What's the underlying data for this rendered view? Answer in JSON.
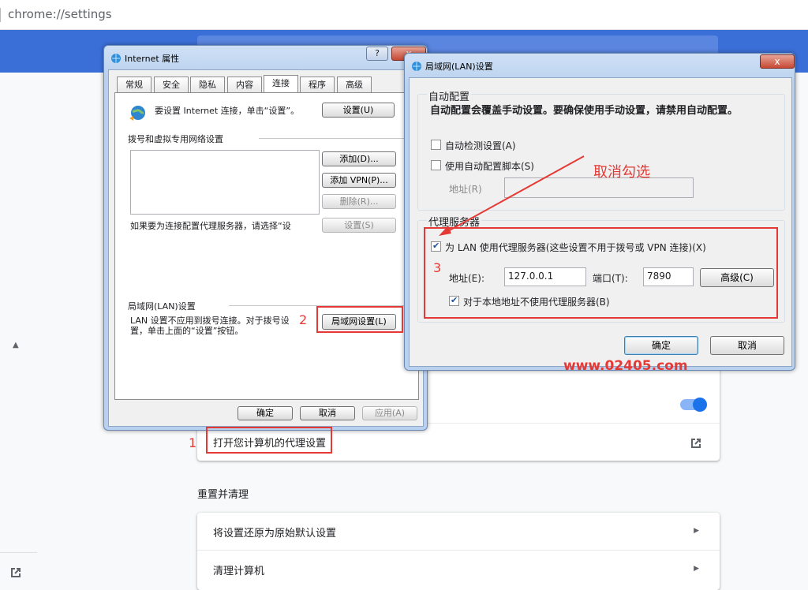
{
  "browser": {
    "url": "chrome://settings"
  },
  "settings": {
    "proxy_row_label": "打开您计算机的代理设置",
    "reset_section_title": "重置并清理",
    "reset_items": [
      "将设置还原为原始默认设置",
      "清理计算机"
    ]
  },
  "ie_dialog": {
    "title": "Internet 属性",
    "help_btn": "?",
    "close_btn": "x",
    "tabs": [
      "常规",
      "安全",
      "隐私",
      "内容",
      "连接",
      "程序",
      "高级"
    ],
    "active_tab": "连接",
    "setup_text": "要设置 Internet 连接，单击“设置”。",
    "setup_btn": "设置(U)",
    "dialup_group": "拨号和虚拟专用网络设置",
    "add_btn": "添加(D)...",
    "add_vpn_btn": "添加 VPN(P)...",
    "delete_btn": "删除(R)...",
    "proxy_hint": "如果要为连接配置代理服务器，请选择“设",
    "settings_btn": "设置(S)",
    "lan_group": "局域网(LAN)设置",
    "lan_text_1": "LAN 设置不应用到拨号连接。对于拨号设",
    "lan_text_2": "置，单击上面的“设置”按钮。",
    "lan_btn": "局域网设置(L)",
    "ok_btn": "确定",
    "cancel_btn": "取消",
    "apply_btn": "应用(A)"
  },
  "lan_dialog": {
    "title": "局域网(LAN)设置",
    "close_btn": "x",
    "auto_group": "自动配置",
    "auto_desc": "自动配置会覆盖手动设置。要确保使用手动设置，请禁用自动配置。",
    "auto_detect": {
      "label": "自动检测设置(A)",
      "checked": false
    },
    "auto_script": {
      "label": "使用自动配置脚本(S)",
      "checked": false
    },
    "address_label": "地址(R)",
    "proxy_group": "代理服务器",
    "use_proxy": {
      "label": "为 LAN 使用代理服务器(这些设置不用于拨号或 VPN 连接)(X)",
      "checked": true
    },
    "proxy_address_label": "地址(E):",
    "proxy_address": "127.0.0.1",
    "port_label": "端口(T):",
    "port": "7890",
    "advanced_btn": "高级(C)",
    "bypass_local": {
      "label": "对于本地地址不使用代理服务器(B)",
      "checked": true
    },
    "ok_btn": "确定",
    "cancel_btn": "取消"
  },
  "annotations": {
    "step1": "1",
    "step2": "2",
    "step3": "3",
    "uncheck": "取消勾选",
    "watermark": "www.02405.com",
    "color": "#e53935"
  }
}
